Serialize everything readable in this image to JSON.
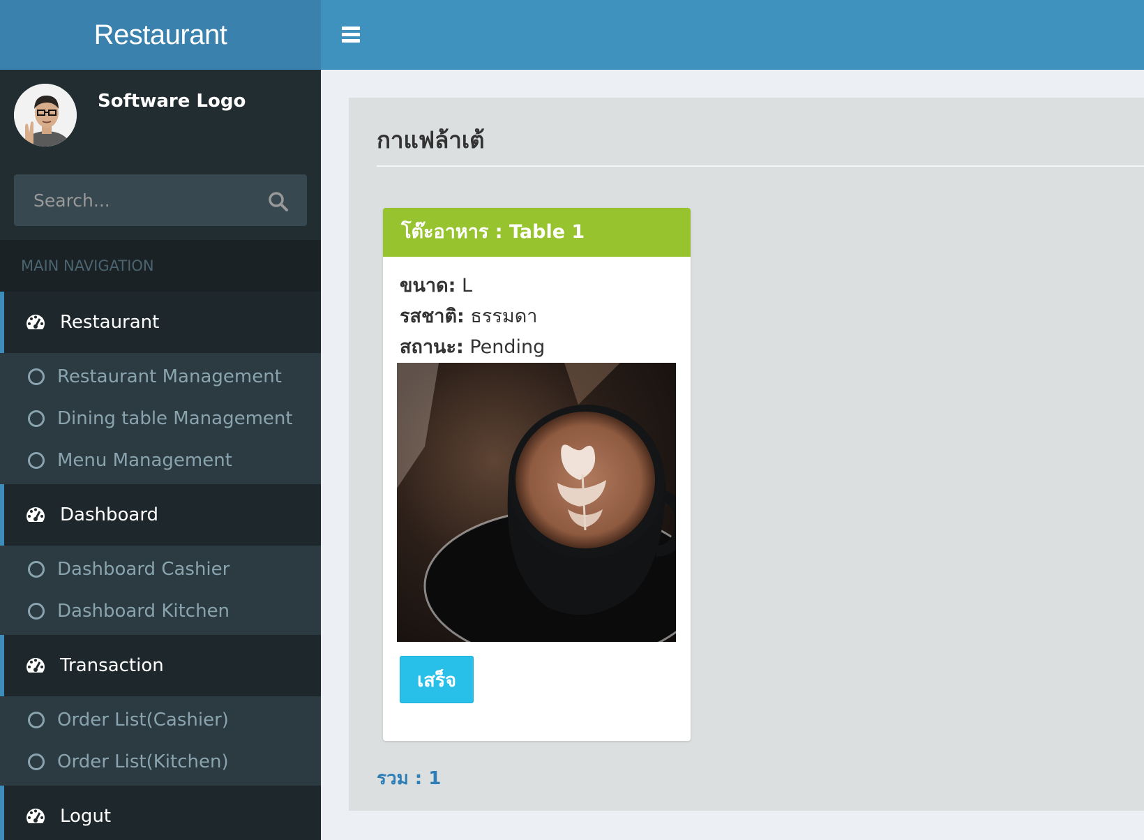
{
  "app": {
    "title": "Restaurant"
  },
  "user": {
    "name": "Software Logo"
  },
  "search": {
    "placeholder": "Search..."
  },
  "nav": {
    "header": "MAIN NAVIGATION",
    "sections": [
      {
        "label": "Restaurant",
        "items": [
          "Restaurant Management",
          "Dining table Management",
          "Menu Management"
        ]
      },
      {
        "label": "Dashboard",
        "items": [
          "Dashboard Cashier",
          "Dashboard Kitchen"
        ]
      },
      {
        "label": "Transaction",
        "items": [
          "Order List(Cashier)",
          "Order List(Kitchen)"
        ]
      },
      {
        "label": "Logut",
        "items": []
      }
    ]
  },
  "page": {
    "title": "กาแฟล้าเต้"
  },
  "order": {
    "header": "โต๊ะอาหาร : Table 1",
    "size_label": "ขนาด:",
    "size_value": "L",
    "taste_label": "รสชาติ:",
    "taste_value": "ธรรมดา",
    "status_label": "สถานะ:",
    "status_value": "Pending",
    "done_label": "เสร็จ"
  },
  "total": {
    "text": "รวม : 1"
  },
  "colors": {
    "header": "#3f91be",
    "card_header": "#97c32e",
    "done_button": "#28bfe9",
    "sidebar": "#222d32"
  }
}
